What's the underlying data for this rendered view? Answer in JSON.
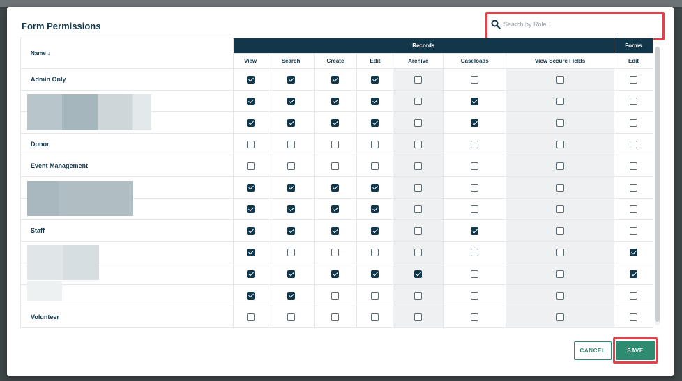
{
  "modal": {
    "title": "Form Permissions",
    "search_placeholder": "Search by Role..."
  },
  "table": {
    "name_header": "Name ↓",
    "group_records": "Records",
    "group_forms": "Forms",
    "columns": [
      "View",
      "Search",
      "Create",
      "Edit",
      "Archive",
      "Caseloads",
      "View Secure Fields",
      "Edit"
    ],
    "shaded_columns": [
      4,
      6
    ],
    "rows": [
      {
        "name": "Admin Only",
        "checks": [
          1,
          1,
          1,
          1,
          0,
          0,
          0,
          0
        ]
      },
      {
        "name": "",
        "checks": [
          1,
          1,
          1,
          1,
          0,
          1,
          0,
          0
        ]
      },
      {
        "name": "",
        "checks": [
          1,
          1,
          1,
          1,
          0,
          1,
          0,
          0
        ]
      },
      {
        "name": "Donor",
        "checks": [
          0,
          0,
          0,
          0,
          0,
          0,
          0,
          0
        ]
      },
      {
        "name": "Event Management",
        "checks": [
          0,
          0,
          0,
          0,
          0,
          0,
          0,
          0
        ]
      },
      {
        "name": "",
        "checks": [
          1,
          1,
          1,
          1,
          0,
          0,
          0,
          0
        ]
      },
      {
        "name": "",
        "checks": [
          1,
          1,
          1,
          1,
          0,
          0,
          0,
          0
        ]
      },
      {
        "name": "Staff",
        "checks": [
          1,
          1,
          1,
          1,
          0,
          1,
          0,
          0
        ]
      },
      {
        "name": "",
        "checks": [
          1,
          0,
          0,
          0,
          0,
          0,
          0,
          1
        ]
      },
      {
        "name": "",
        "checks": [
          1,
          1,
          1,
          1,
          1,
          0,
          0,
          1
        ]
      },
      {
        "name": "",
        "checks": [
          1,
          1,
          0,
          0,
          0,
          0,
          0,
          0
        ]
      },
      {
        "name": "Volunteer",
        "checks": [
          0,
          0,
          0,
          0,
          0,
          0,
          0,
          0
        ]
      }
    ]
  },
  "footer": {
    "cancel_label": "CANCEL",
    "save_label": "SAVE"
  },
  "colors": {
    "header_bg": "#12364a",
    "accent": "#2f8a72",
    "highlight": "#e0444a"
  }
}
